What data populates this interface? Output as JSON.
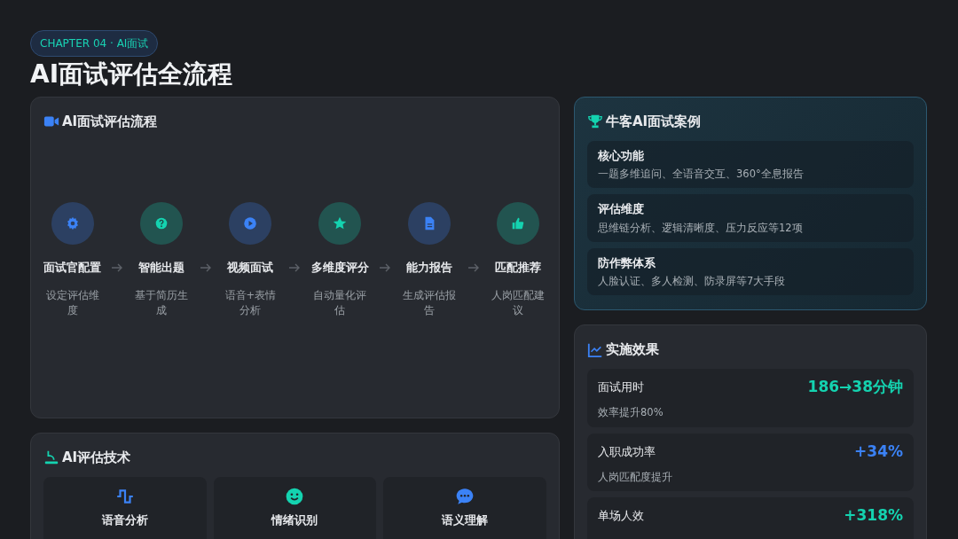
{
  "chip": "CHAPTER 04 · AI面试",
  "title": "AI面试评估全流程",
  "flow": {
    "title": "AI面试评估流程",
    "steps": [
      {
        "kind": "gear",
        "color": "#3b82f6",
        "title": "面试官配置",
        "desc": "设定评估维度"
      },
      {
        "kind": "question",
        "color": "#14d3b0",
        "title": "智能出题",
        "desc": "基于简历生成"
      },
      {
        "kind": "play",
        "color": "#3b82f6",
        "title": "视频面试",
        "desc": "语音+表情分析"
      },
      {
        "kind": "star",
        "color": "#14d3b0",
        "title": "多维度评分",
        "desc": "自动量化评估"
      },
      {
        "kind": "doc",
        "color": "#3b82f6",
        "title": "能力报告",
        "desc": "生成评估报告"
      },
      {
        "kind": "thumb",
        "color": "#14d3b0",
        "title": "匹配推荐",
        "desc": "人岗匹配建议"
      }
    ]
  },
  "tech": {
    "title": "AI评估技术",
    "items": [
      {
        "kind": "wave",
        "color": "#3b82f6",
        "title": "语音分析"
      },
      {
        "kind": "smile",
        "color": "#14d3b0",
        "title": "情绪识别"
      },
      {
        "kind": "chat",
        "color": "#3b82f6",
        "title": "语义理解"
      }
    ]
  },
  "case": {
    "title": "牛客AI面试案例",
    "items": [
      {
        "title": "核心功能",
        "desc": "一题多维追问、全语音交互、360°全息报告"
      },
      {
        "title": "评估维度",
        "desc": "思维链分析、逻辑清晰度、压力反应等12项"
      },
      {
        "title": "防作弊体系",
        "desc": "人脸认证、多人检测、防录屏等7大手段"
      }
    ]
  },
  "effect": {
    "title": "实施效果",
    "items": [
      {
        "label": "面试用时",
        "value": "186→38分钟",
        "color": "#14d3b0",
        "desc": "效率提升80%"
      },
      {
        "label": "入职成功率",
        "value": "+34%",
        "color": "#3b82f6",
        "desc": "人岗匹配度提升"
      },
      {
        "label": "单场人效",
        "value": "+318%",
        "color": "#14d3b0"
      }
    ]
  }
}
